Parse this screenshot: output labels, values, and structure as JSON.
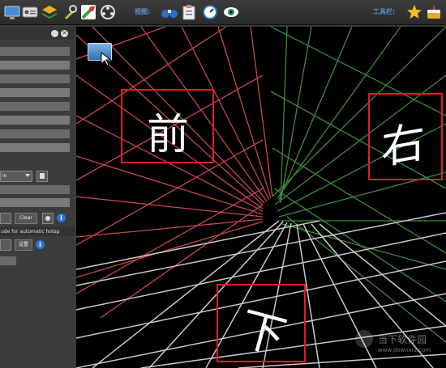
{
  "toolbar": {
    "view_label": "视图:",
    "tools_label": "工具栏:"
  },
  "sidebar": {
    "dropdown_value": "le",
    "clear_label": "Clear",
    "hint_text": "ude for automatic hotsp",
    "settings_label": "设置"
  },
  "viewport": {
    "faces": {
      "front": "前",
      "right": "右",
      "bottom": "下"
    }
  },
  "watermark": {
    "name": "当下软件园",
    "url": "www.downxia.com"
  }
}
